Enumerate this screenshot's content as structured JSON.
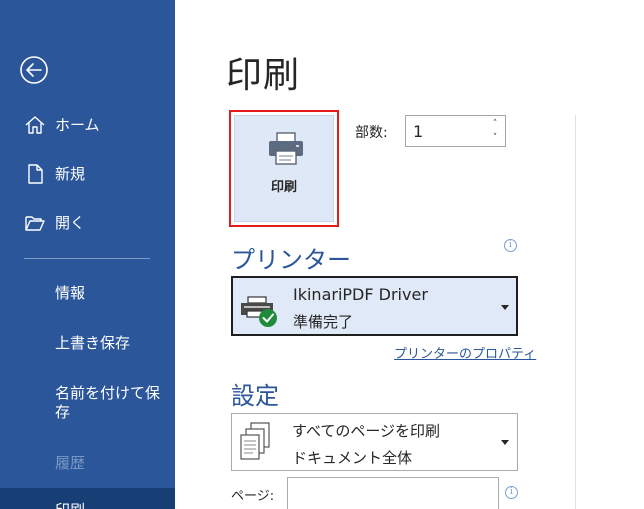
{
  "sidebar": {
    "back_label": "戻る",
    "items": [
      {
        "label": "ホーム",
        "icon": "home-icon"
      },
      {
        "label": "新規",
        "icon": "new-document-icon"
      },
      {
        "label": "開く",
        "icon": "open-folder-icon"
      }
    ],
    "info": "情報",
    "save_overwrite": "上書き保存",
    "save_as": "名前を付けて保\n存",
    "history": "履歴",
    "print": "印刷"
  },
  "main": {
    "title": "印刷",
    "print_button": {
      "label": "印刷",
      "icon": "printer-icon"
    },
    "copies": {
      "label": "部数:",
      "value": "1"
    },
    "printer_section": {
      "heading": "プリンター",
      "name": "IkinariPDF Driver",
      "status": "準備完了",
      "icon": "printer-ready-icon",
      "properties_link": "プリンターのプロパティ"
    },
    "settings_section": {
      "heading": "設定",
      "range_title": "すべてのページを印刷",
      "range_sub": "ドキュメント全体",
      "range_icon": "pages-icon",
      "pages_label": "ページ:",
      "pages_value": ""
    }
  },
  "colors": {
    "sidebar_bg": "#2b579a",
    "sidebar_active": "#173e75",
    "accent": "#2b579a",
    "highlight_border": "#e31b1b",
    "selected_bg": "#e0e9f8"
  }
}
